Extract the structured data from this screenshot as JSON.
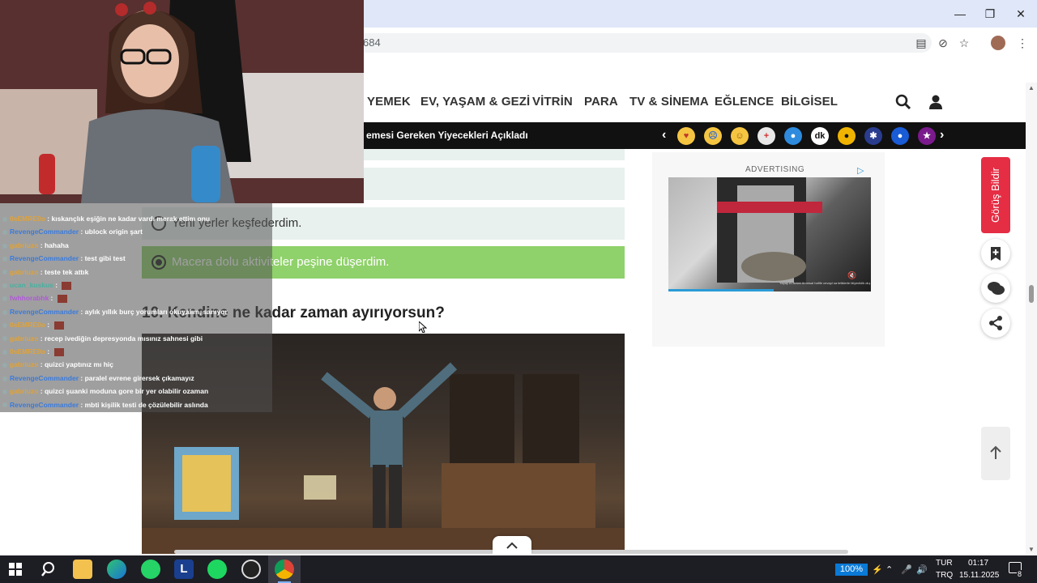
{
  "browser": {
    "url_fragment": "684",
    "window_controls": [
      "minimize",
      "restore",
      "close"
    ]
  },
  "nav": {
    "items": [
      "YEMEK",
      "EV, YAŞAM & GEZİ",
      "VİTRİN",
      "PARA",
      "TV & SİNEMA",
      "EĞLENCE",
      "BİLGİSEL"
    ]
  },
  "ticker": {
    "headline": "emesi Gereken Yiyecekleri Açıkladı"
  },
  "quiz": {
    "options": [
      "m.",
      "Yeni yerler keşfederdim.",
      "Macera dolu aktiviteler peşine düşerdim."
    ],
    "selected_index": 2,
    "question": "10. Kendine ne kadar zaman ayırıyorsun?"
  },
  "ad": {
    "label": "ADVERTISING",
    "caption": "Yapay AI Anlatı Anımsal hafife cevapl sa tetiklerle bilyeciklik olup Gol"
  },
  "sidebar": {
    "feedback_label": "Görüş Bildir"
  },
  "chat": {
    "messages": [
      {
        "user": "0sEMRE0o",
        "user_color": "#e0a33a",
        "text": "kıskançlık eşiğin ne kadar vardı merak ettim onu"
      },
      {
        "user": "RevengeCommander",
        "user_color": "#3a7bdc",
        "text": "ublock origin şart"
      },
      {
        "user": "gabriuzo",
        "user_color": "#e0a33a",
        "text": "hahaha"
      },
      {
        "user": "RevengeCommander",
        "user_color": "#3a7bdc",
        "text": "test gibi test"
      },
      {
        "user": "gabriuzo",
        "user_color": "#e0a33a",
        "text": "teste tek attık"
      },
      {
        "user": "ucan_kuskus",
        "user_color": "#4ab0a0",
        "text": ""
      },
      {
        "user": "fwhhorabhk",
        "user_color": "#b05ad8",
        "text": ""
      },
      {
        "user": "RevengeCommander",
        "user_color": "#3a7bdc",
        "text": "aylık yıllık burç yorumları okuyalım, sanıyor"
      },
      {
        "user": "0sEMRE0o",
        "user_color": "#e0a33a",
        "text": ""
      },
      {
        "user": "gabriuzo",
        "user_color": "#e0a33a",
        "text": "recep ivediğin depresyonda mısınız sahnesi gibi"
      },
      {
        "user": "0sEMRE0o",
        "user_color": "#e0a33a",
        "text": ""
      },
      {
        "user": "gabriuzo",
        "user_color": "#e0a33a",
        "text": "quizci yaptınız mı hiç"
      },
      {
        "user": "RevengeCommander",
        "user_color": "#3a7bdc",
        "text": "paralel evrene girersek çıkamayız"
      },
      {
        "user": "gabriuzo",
        "user_color": "#e0a33a",
        "text": "quizci şuanki moduna gore bir yer olabilir ozaman"
      },
      {
        "user": "RevengeCommander",
        "user_color": "#3a7bdc",
        "text": "mbti kişilik testi de çözülebilir aslında"
      }
    ]
  },
  "taskbar": {
    "battery": "100%",
    "lang_top": "TUR",
    "lang_bottom": "TRQ",
    "time": "01:17",
    "date": "15.11.2025",
    "notification_count": "8",
    "apps": [
      "start",
      "search",
      "file-explorer",
      "edge",
      "whatsapp",
      "l-app",
      "spotify",
      "obs",
      "chrome"
    ]
  },
  "colors": {
    "accent_green": "#8fd16a",
    "feedback_red": "#e52d44",
    "ticker_bg": "#111111"
  }
}
